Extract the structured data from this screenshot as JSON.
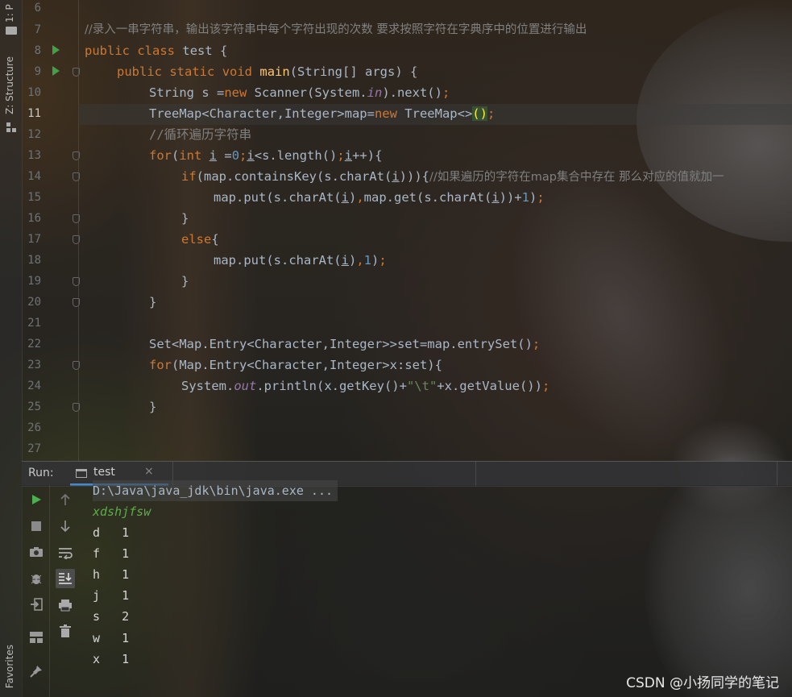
{
  "sidebar": {
    "project_tab": "1: P",
    "structure_tab": "Z: Structure",
    "favorites_tab": "Favorites"
  },
  "editor": {
    "line_numbers": [
      "6",
      "7",
      "8",
      "9",
      "10",
      "11",
      "12",
      "13",
      "14",
      "15",
      "16",
      "17",
      "18",
      "19",
      "20",
      "21",
      "22",
      "23",
      "24",
      "25",
      "26",
      "27"
    ],
    "current_line": "11",
    "lines": {
      "l7_comment": "//录入一串字符串，输出该字符串中每个字符出现的次数 要求按照字符在字典序中的位置进行输出",
      "l8_public": "public",
      "l8_class": "class",
      "l8_name": "test {",
      "l9_public": "public",
      "l9_static": "static",
      "l9_void": "void",
      "l9_method": "main",
      "l9_params": "(String[] args) {",
      "l10_a": "String s =",
      "l10_new": "new",
      "l10_b": " Scanner(System.",
      "l10_in": "in",
      "l10_c": ").next()",
      "l10_semi": ";",
      "l11_a": "TreeMap<Character,Integer>map=",
      "l11_new": "new",
      "l11_b": " TreeMap<>",
      "l11_paren": "()",
      "l11_semi": ";",
      "l12_comment": "//循环遍历字符串",
      "l13_for": "for",
      "l13_a": "(",
      "l13_int": "int",
      "l13_i": "i",
      "l13_b": " =",
      "l13_zero": "0",
      "l13_semi1": ";",
      "l13_i2": "i",
      "l13_c": "<s.length()",
      "l13_semi2": ";",
      "l13_i3": "i",
      "l13_d": "++){",
      "l14_if": "if",
      "l14_a": "(map.containsKey(s.charAt(",
      "l14_i": "i",
      "l14_b": "))){",
      "l14_comment": "//如果遍历的字符在map集合中存在 那么对应的值就加一",
      "l15_a": "map.put(s.charAt(",
      "l15_i": "i",
      "l15_b": ")",
      "l15_comma": ",",
      "l15_c": "map.get(s.charAt(",
      "l15_i2": "i",
      "l15_d": "))+",
      "l15_one": "1",
      "l15_e": ")",
      "l15_semi": ";",
      "l16": "}",
      "l17_else": "else",
      "l17_b": "{",
      "l18_a": "map.put(s.charAt(",
      "l18_i": "i",
      "l18_b": ")",
      "l18_comma": ",",
      "l18_one": "1",
      "l18_c": ")",
      "l18_semi": ";",
      "l19": "}",
      "l20": "}",
      "l22_a": "Set<Map.Entry<Character,Integer>>set=map.entrySet()",
      "l22_semi": ";",
      "l23_for": "for",
      "l23_a": "(Map.Entry<Character,Integer>x:set){",
      "l24_a": "System.",
      "l24_out": "out",
      "l24_b": ".println(x.getKey()+",
      "l24_str": "\"\\t\"",
      "l24_c": "+x.getValue())",
      "l24_semi": ";",
      "l25": "}"
    }
  },
  "run_panel": {
    "label": "Run:",
    "tab_label": "test",
    "tab_close": "×",
    "command": "D:\\Java\\java_jdk\\bin\\java.exe ...",
    "input": "xdshjfsw",
    "output_rows": [
      {
        "key": "d",
        "value": "1"
      },
      {
        "key": "f",
        "value": "1"
      },
      {
        "key": "h",
        "value": "1"
      },
      {
        "key": "j",
        "value": "1"
      },
      {
        "key": "s",
        "value": "2"
      },
      {
        "key": "w",
        "value": "1"
      },
      {
        "key": "x",
        "value": "1"
      }
    ],
    "tools_left": [
      "run-icon",
      "stop-icon",
      "camera-icon",
      "debug-icon",
      "login-icon",
      "layout-icon",
      "pin-icon"
    ],
    "tools_right": [
      "up-arrow-icon",
      "down-arrow-icon",
      "soft-wrap-icon",
      "scroll-to-end-icon",
      "print-icon",
      "trash-icon"
    ]
  },
  "watermark": "CSDN @小扬同学的笔记",
  "colors": {
    "keyword": "#cc7832",
    "method": "#ffc66d",
    "number": "#6897bb",
    "string": "#6a8759",
    "comment": "#808080",
    "static_field": "#9876aa",
    "input_text": "#5cae4a",
    "tab_underline": "#4a88c7",
    "run_green": "#43a047"
  }
}
